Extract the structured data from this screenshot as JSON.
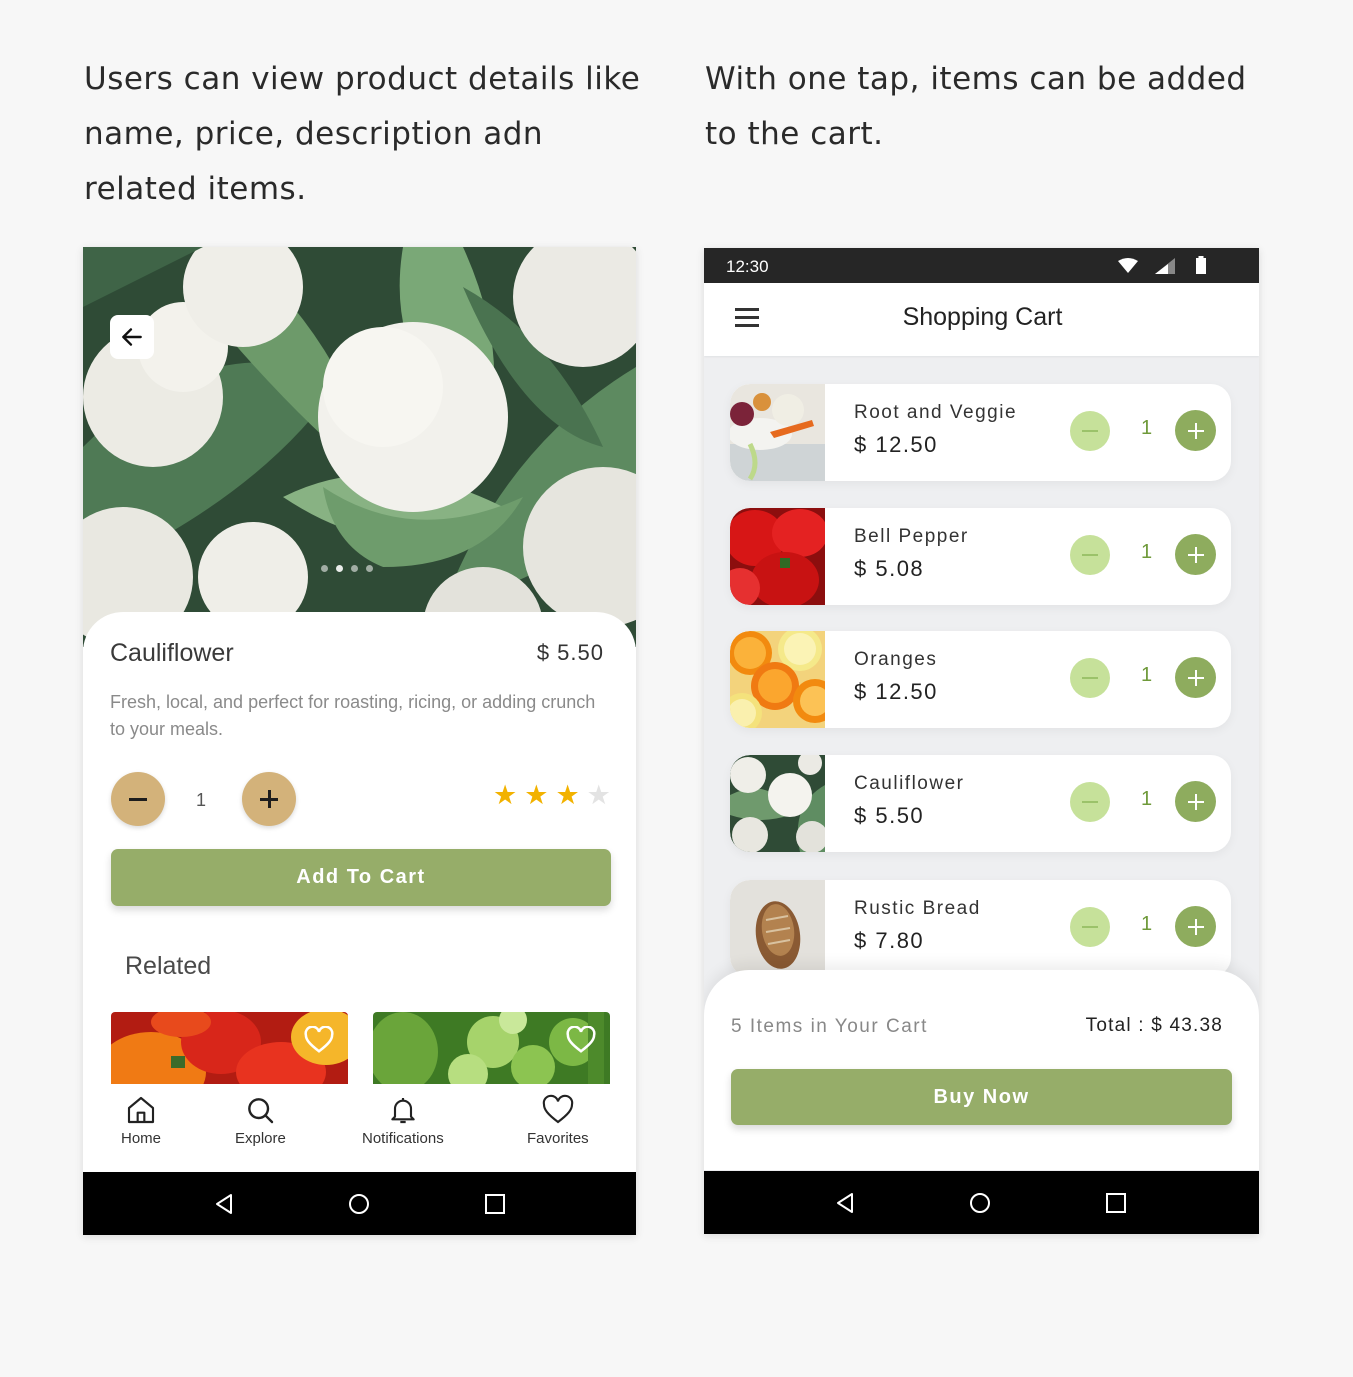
{
  "captions": {
    "left": "Users can view product details like name, price, description adn related items.",
    "right": "With one tap, items can be added to the cart."
  },
  "product_screen": {
    "name": "Cauliflower",
    "price": "$ 5.50",
    "description": "Fresh, local, and perfect for roasting, ricing, or adding crunch to your meals.",
    "quantity": "1",
    "rating": {
      "value": 3,
      "max": 5
    },
    "add_to_cart_label": "Add To Cart",
    "related_title": "Related",
    "related_items": [
      {
        "image": "bell-peppers-image",
        "favorite_icon": "heart-outline-icon"
      },
      {
        "image": "green-vegetables-image",
        "favorite_icon": "heart-outline-icon"
      }
    ],
    "bottom_nav": [
      {
        "label": "Home",
        "icon": "home-icon"
      },
      {
        "label": "Explore",
        "icon": "search-icon"
      },
      {
        "label": "Notifications",
        "icon": "bell-icon"
      },
      {
        "label": "Favorites",
        "icon": "heart-icon"
      }
    ],
    "colors": {
      "accent": "#96ad69",
      "qty_button": "#d3b27a",
      "star": "#f2b200"
    }
  },
  "cart_screen": {
    "status_time": "12:30",
    "title": "Shopping Cart",
    "items": [
      {
        "name": "Root and Veggie",
        "price": "$ 12.50",
        "quantity": "1"
      },
      {
        "name": "Bell Pepper",
        "price": "$ 5.08",
        "quantity": "1"
      },
      {
        "name": "Oranges",
        "price": "$ 12.50",
        "quantity": "1"
      },
      {
        "name": "Cauliflower",
        "price": "$ 5.50",
        "quantity": "1"
      },
      {
        "name": "Rustic Bread",
        "price": "$ 7.80",
        "quantity": "1"
      }
    ],
    "item_count_label": "5 Items in Your Cart",
    "total_label": "Total : $ 43.38",
    "buy_now_label": "Buy Now",
    "colors": {
      "accent": "#96ad69",
      "minus_button": "#c6e19a",
      "plus_button": "#8eac5e"
    }
  }
}
